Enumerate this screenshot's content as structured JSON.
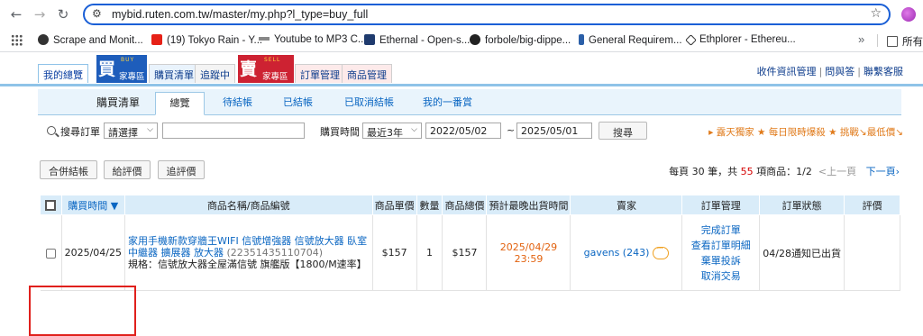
{
  "browser": {
    "url": "mybid.ruten.com.tw/master/my.php?l_type=buy_full",
    "bookmarks": [
      {
        "label": "Scrape and Monit...",
        "icon": "cloud-icon",
        "color": "#333333"
      },
      {
        "label": "(19) Tokyo Rain - Y...",
        "icon": "youtube-icon",
        "color": "#e62117"
      },
      {
        "label": "Youtube to MP3 C...",
        "icon": "arrows-icon",
        "color": "#555555"
      },
      {
        "label": "Ethernal - Open-s...",
        "icon": "e-icon",
        "color": "#1f3b6e"
      },
      {
        "label": "forbole/big-dippe...",
        "icon": "github-icon",
        "color": "#222222"
      },
      {
        "label": "General Requirem...",
        "icon": "bar-icon",
        "color": "#2b5fa8"
      },
      {
        "label": "Ethplorer - Ethereu...",
        "icon": "diamond-icon",
        "color": "#333333"
      }
    ],
    "folder_label": "所有"
  },
  "header": {
    "my_overview": "我的總覽",
    "buy_logo_big": "買",
    "buy_logo_small": "BUY",
    "buy_logo_label": "家專區",
    "buy_list": "購買清單",
    "tracking": "追蹤中",
    "sell_logo_big": "賣",
    "sell_logo_small": "SELL",
    "sell_logo_label": "家專區",
    "order_mgmt": "訂單管理",
    "goods_mgmt": "商品管理",
    "links": [
      "收件資訊管理",
      "問與答",
      "聯繫客服"
    ]
  },
  "subtabs": {
    "title": "購買清單",
    "tabs": [
      "總覽",
      "待結帳",
      "已結帳",
      "已取消結帳",
      "我的一番賞"
    ]
  },
  "filter": {
    "search_label": "搜尋訂單",
    "search_select": "請選擇",
    "search_value": "",
    "time_label": "購買時間",
    "range_select": "最近3年",
    "date_from": "2022/05/02",
    "tilde": "~",
    "date_to": "2025/05/01",
    "search_button": "搜尋",
    "promo": "▸ 露天獨家 ★ 每日限時爆殺 ★ 挑戰↘最低價↘"
  },
  "actions": {
    "merge_checkout": "合併結帳",
    "give_rating": "給評價",
    "track_rating": "追評價"
  },
  "pager": {
    "per_page_prefix": "每頁 30 筆，共",
    "total": "55",
    "per_page_suffix": "項商品：1/2",
    "prev": "<上一頁",
    "next": "下一頁›"
  },
  "table": {
    "headers": [
      "購買時間 ▼",
      "商品名稱/商品編號",
      "商品單價",
      "數量",
      "商品總價",
      "預計最晚出貨時間",
      "賣家",
      "訂單管理",
      "訂單狀態",
      "評價"
    ],
    "rows": [
      {
        "date": "2025/04/25",
        "product_name": "家用手機新款穿牆王WIFI 信號增強器 信號放大器 臥室中繼器 擴展器 放大器",
        "product_id": "(22351435110704)",
        "spec": "規格：信號放大器全屋滿信號 旗艦版【1800/M速率】",
        "unit_price": "$157",
        "qty": "1",
        "total": "$157",
        "ship_date": "2025/04/29",
        "ship_time": "23:59",
        "seller": "gavens (243)",
        "order_links": [
          "完成訂單",
          "查看訂單明細",
          "棄單投訴",
          "取消交易"
        ],
        "status": "04/28通知已出貨",
        "rating": ""
      }
    ]
  }
}
